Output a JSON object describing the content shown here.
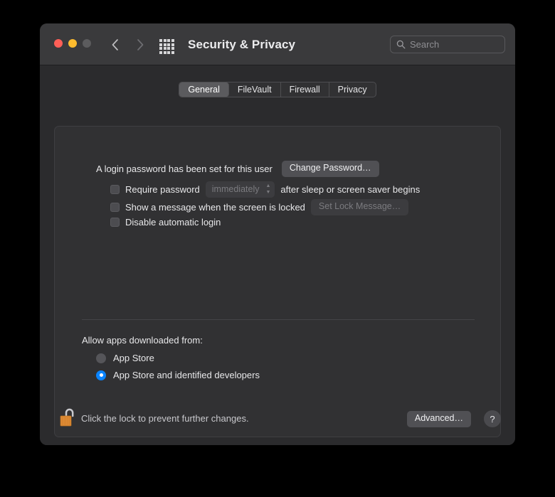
{
  "window": {
    "title": "Security & Privacy",
    "traffic_lights": [
      "close",
      "minimize",
      "zoom"
    ],
    "back_icon": "chevron-left-icon",
    "forward_icon": "chevron-right-icon",
    "grid_icon": "show-all-grid-icon"
  },
  "search": {
    "placeholder": "Search",
    "value": "",
    "icon": "search-icon"
  },
  "tabs": [
    {
      "label": "General",
      "active": true
    },
    {
      "label": "FileVault",
      "active": false
    },
    {
      "label": "Firewall",
      "active": false
    },
    {
      "label": "Privacy",
      "active": false
    }
  ],
  "general": {
    "password_status": "A login password has been set for this user",
    "change_password_button": "Change Password…",
    "require_password_label": "Require password",
    "require_password_value": "immediately",
    "require_password_suffix": "after sleep or screen saver begins",
    "show_message_label": "Show a message when the screen is locked",
    "set_lock_message_button": "Set Lock Message…",
    "disable_auto_login_label": "Disable automatic login",
    "allow_apps_title": "Allow apps downloaded from:",
    "allow_apps_options": [
      {
        "label": "App Store",
        "selected": false
      },
      {
        "label": "App Store and identified developers",
        "selected": true
      }
    ]
  },
  "footer": {
    "lock_icon": "unlocked-padlock-icon",
    "lock_note": "Click the lock to prevent further changes.",
    "advanced_button": "Advanced…",
    "help_button": "?"
  },
  "colors": {
    "accent": "#0a84ff",
    "window_body": "#2b2b2d",
    "titlebar": "#3a3a3c",
    "panel": "#313133",
    "close": "#ff5f57",
    "minimize": "#febc2e",
    "zoom": "#5c5c5e",
    "lock_body": "#e08b34"
  }
}
